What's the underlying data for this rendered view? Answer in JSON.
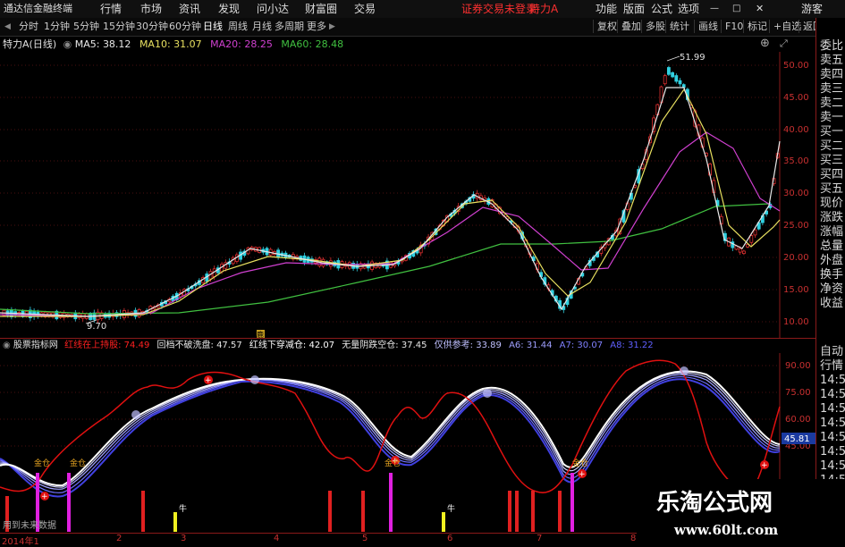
{
  "menubar": {
    "app_title": "通达信金融终端",
    "items": [
      "行情",
      "市场",
      "资讯",
      "发现",
      "问小达",
      "财富圈",
      "交易"
    ],
    "warning": "证券交易未登录",
    "stock": "特力A",
    "right_items": [
      "功能",
      "版面",
      "公式",
      "选项"
    ],
    "guest": "游客"
  },
  "toolbar": {
    "periods": [
      "分时",
      "1分钟",
      "5分钟",
      "15分钟",
      "30分钟",
      "60分钟",
      "日线",
      "周线",
      "月线",
      "多周期",
      "更多"
    ],
    "active_period": "日线",
    "right_buttons": [
      "复权",
      "叠加",
      "多股",
      "统计",
      "画线",
      "F10",
      "标记",
      "+自选",
      "返回"
    ]
  },
  "main_chart": {
    "title": "特力A(日线)",
    "ma": [
      {
        "label": "MA5: ",
        "value": "38.12",
        "color": "#e8e8e8"
      },
      {
        "label": "MA10: ",
        "value": "31.07",
        "color": "#e8e060"
      },
      {
        "label": "MA20: ",
        "value": "28.25",
        "color": "#d040d0"
      },
      {
        "label": "MA60: ",
        "value": "28.48",
        "color": "#40c040"
      }
    ],
    "high_label": "51.99",
    "low_label": "9.70",
    "y_ticks": [
      "50.00",
      "45.00",
      "40.00",
      "35.00",
      "30.00",
      "25.00",
      "20.00",
      "15.00",
      "10.00"
    ],
    "marker": "鹿"
  },
  "indicator": {
    "name": "股票指标网",
    "items": [
      {
        "label": "红线在上持股: ",
        "value": "74.49",
        "color": "#ff2020"
      },
      {
        "label": "回档不破洗盘: ",
        "value": "47.57",
        "color": "#e8e8e8"
      },
      {
        "label": "红线下穿减仓: ",
        "value": "42.07",
        "color": "#ffffff"
      },
      {
        "label": "无量阴跌空仓: ",
        "value": "37.45",
        "color": "#e8e8e8"
      },
      {
        "label": "仅供参考: ",
        "value": "33.89",
        "color": "#c0c0ff"
      },
      {
        "label": "A6: ",
        "value": "31.44",
        "color": "#a0a0ff"
      },
      {
        "label": "A7: ",
        "value": "30.07",
        "color": "#8080ff"
      },
      {
        "label": "A8: ",
        "value": "31.22",
        "color": "#6060ff"
      }
    ],
    "y_ticks": [
      "90.00",
      "75.00",
      "60.00",
      "45.00"
    ],
    "current_value": "45.81",
    "gold_label": "金仓",
    "niu_label": "牛",
    "footer_note": "用到未来数据"
  },
  "x_axis": [
    "2014年1",
    "2",
    "3",
    "4",
    "5",
    "6",
    "7",
    "8"
  ],
  "side_panel": {
    "top": [
      "委比",
      "卖五",
      "卖四",
      "卖三",
      "卖二",
      "卖一",
      "买一",
      "买二",
      "买三",
      "买四",
      "买五",
      "现价",
      "涨跌",
      "涨幅",
      "总量",
      "外盘",
      "换手",
      "净资",
      "收益"
    ],
    "bottom": [
      "自动",
      "行情",
      "14:5",
      "14:5",
      "14:5",
      "14:5",
      "14:5",
      "14:5",
      "14:5",
      "14:5"
    ]
  },
  "watermark": {
    "title": "乐淘公式网",
    "url": "www.60lt.com"
  }
}
